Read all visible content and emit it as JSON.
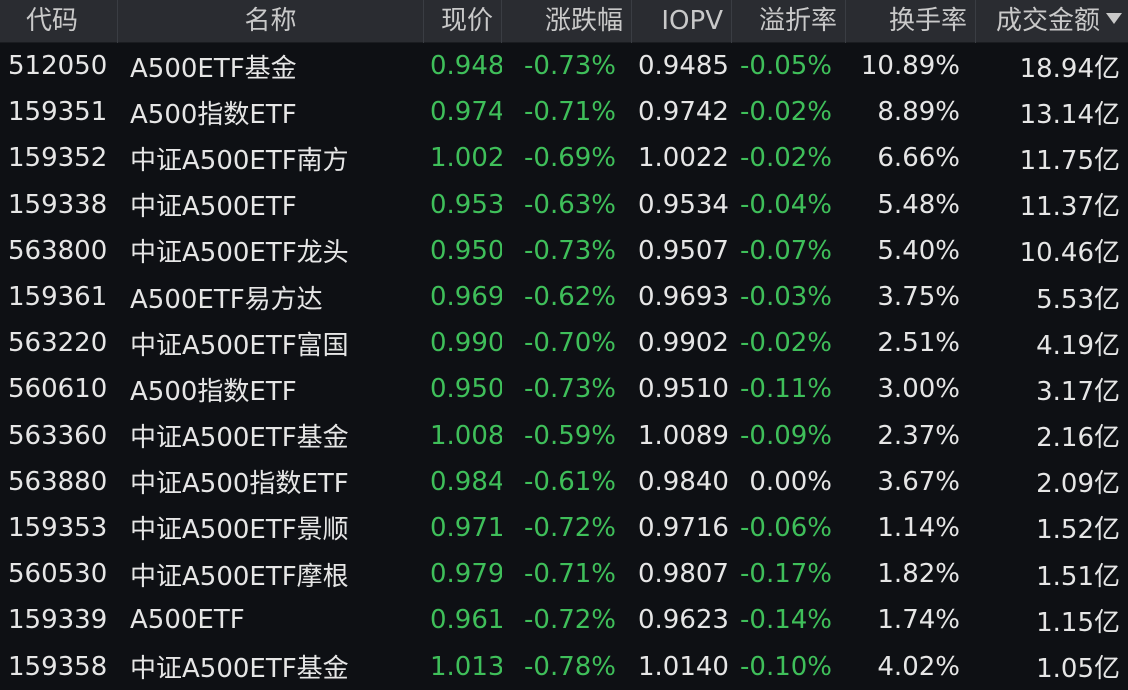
{
  "colors": {
    "background": "#0e1014",
    "header_background": "#2a2c31",
    "text": "#e6e6e6",
    "down": "#3fbf5a"
  },
  "table": {
    "columns": [
      "代码",
      "名称",
      "现价",
      "涨跌幅",
      "IOPV",
      "溢折率",
      "换手率",
      "成交金额"
    ],
    "sort_icon": "sort-down-icon",
    "rows": [
      {
        "code": "512050",
        "name": "A500ETF基金",
        "price": "0.948",
        "change": "-0.73%",
        "iopv": "0.9485",
        "premium": "-0.05%",
        "turnover": "10.89%",
        "amount": "18.94亿"
      },
      {
        "code": "159351",
        "name": "A500指数ETF",
        "price": "0.974",
        "change": "-0.71%",
        "iopv": "0.9742",
        "premium": "-0.02%",
        "turnover": "8.89%",
        "amount": "13.14亿"
      },
      {
        "code": "159352",
        "name": "中证A500ETF南方",
        "price": "1.002",
        "change": "-0.69%",
        "iopv": "1.0022",
        "premium": "-0.02%",
        "turnover": "6.66%",
        "amount": "11.75亿"
      },
      {
        "code": "159338",
        "name": "中证A500ETF",
        "price": "0.953",
        "change": "-0.63%",
        "iopv": "0.9534",
        "premium": "-0.04%",
        "turnover": "5.48%",
        "amount": "11.37亿"
      },
      {
        "code": "563800",
        "name": "中证A500ETF龙头",
        "price": "0.950",
        "change": "-0.73%",
        "iopv": "0.9507",
        "premium": "-0.07%",
        "turnover": "5.40%",
        "amount": "10.46亿"
      },
      {
        "code": "159361",
        "name": "A500ETF易方达",
        "price": "0.969",
        "change": "-0.62%",
        "iopv": "0.9693",
        "premium": "-0.03%",
        "turnover": "3.75%",
        "amount": "5.53亿"
      },
      {
        "code": "563220",
        "name": "中证A500ETF富国",
        "price": "0.990",
        "change": "-0.70%",
        "iopv": "0.9902",
        "premium": "-0.02%",
        "turnover": "2.51%",
        "amount": "4.19亿"
      },
      {
        "code": "560610",
        "name": "A500指数ETF",
        "price": "0.950",
        "change": "-0.73%",
        "iopv": "0.9510",
        "premium": "-0.11%",
        "turnover": "3.00%",
        "amount": "3.17亿"
      },
      {
        "code": "563360",
        "name": "中证A500ETF基金",
        "price": "1.008",
        "change": "-0.59%",
        "iopv": "1.0089",
        "premium": "-0.09%",
        "turnover": "2.37%",
        "amount": "2.16亿"
      },
      {
        "code": "563880",
        "name": "中证A500指数ETF",
        "price": "0.984",
        "change": "-0.61%",
        "iopv": "0.9840",
        "premium": "0.00%",
        "turnover": "3.67%",
        "amount": "2.09亿"
      },
      {
        "code": "159353",
        "name": "中证A500ETF景顺",
        "price": "0.971",
        "change": "-0.72%",
        "iopv": "0.9716",
        "premium": "-0.06%",
        "turnover": "1.14%",
        "amount": "1.52亿"
      },
      {
        "code": "560530",
        "name": "中证A500ETF摩根",
        "price": "0.979",
        "change": "-0.71%",
        "iopv": "0.9807",
        "premium": "-0.17%",
        "turnover": "1.82%",
        "amount": "1.51亿"
      },
      {
        "code": "159339",
        "name": "A500ETF",
        "price": "0.961",
        "change": "-0.72%",
        "iopv": "0.9623",
        "premium": "-0.14%",
        "turnover": "1.74%",
        "amount": "1.15亿"
      },
      {
        "code": "159358",
        "name": "中证A500ETF基金",
        "price": "1.013",
        "change": "-0.78%",
        "iopv": "1.0140",
        "premium": "-0.10%",
        "turnover": "4.02%",
        "amount": "1.05亿"
      }
    ]
  }
}
